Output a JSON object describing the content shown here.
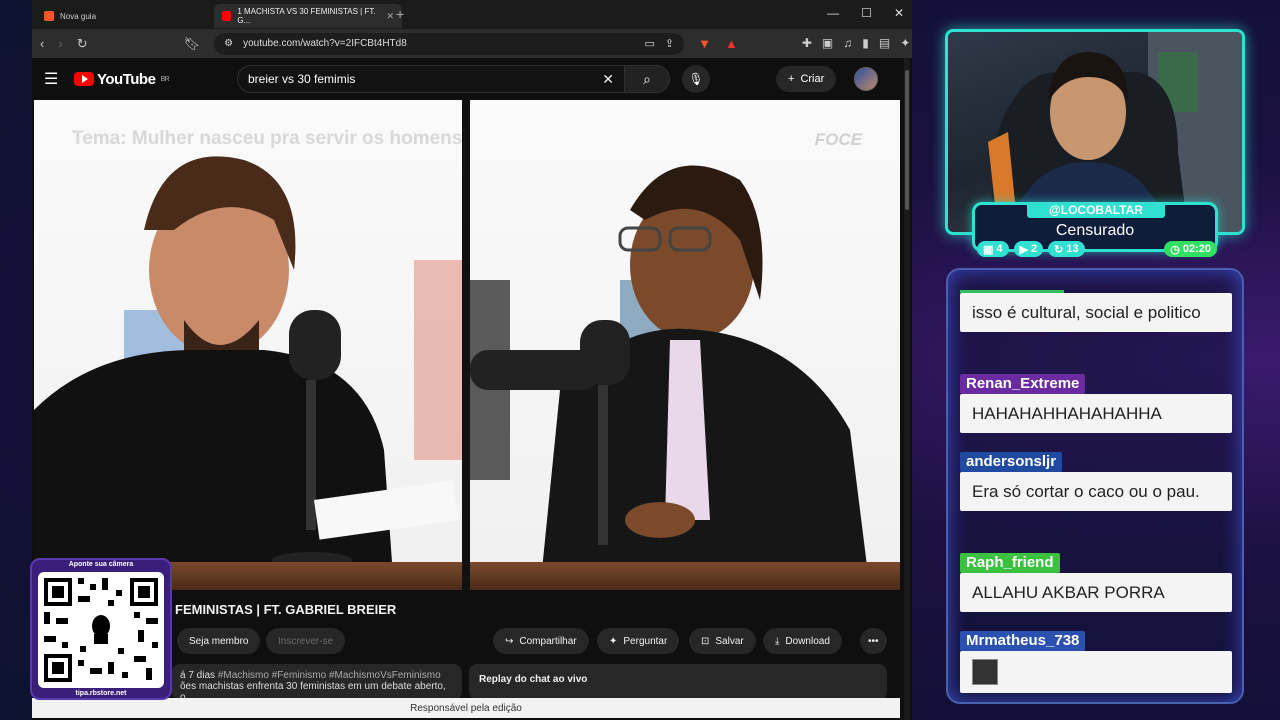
{
  "browser": {
    "tabs": [
      {
        "label": "Nova guia"
      },
      {
        "label": "1 MACHISTA VS 30 FEMINISTAS | FT. G..."
      }
    ],
    "url": "youtube.com/watch?v=2IFCBt4HTd8"
  },
  "youtube": {
    "brand": "YouTube",
    "region": "BR",
    "search_value": "breier vs 30 femimis",
    "create_label": "Criar",
    "video_overlay_title": "Tema: Mulher nasceu pra servir os homens",
    "watermark": "FOCE",
    "video_title": "FEMINISTAS | FT. GABRIEL BREIER",
    "member_label": "Seja membro",
    "subscribe_label": "Inscrever-se",
    "share_label": "Compartilhar",
    "ask_label": "Perguntar",
    "save_label": "Salvar",
    "download_label": "Download",
    "desc_age": "á 7 dias",
    "desc_tags": "#Machismo #Feminismo #MachismoVsFeminismo",
    "desc_snippet": "ões machistas enfrenta 30 feministas em um debate aberto, o",
    "replay_label": "Replay do chat ao vivo",
    "footer_label": "Responsável pela edição"
  },
  "qr": {
    "caption_top": "Aponte sua câmera",
    "caption_bottom": "tipa.rbstore.net"
  },
  "stream": {
    "username": "@LOCOBALTAR",
    "status": "Censurado",
    "stats": {
      "chat": "4",
      "video": "2",
      "subs": "13",
      "time": "02:20"
    }
  },
  "chat": {
    "messages": [
      {
        "user": "",
        "text": "isso é cultural, social e politico",
        "color": "#30c060"
      },
      {
        "user": "Renan_Extreme",
        "text": "HAHAHAHHAHAHAHHA",
        "color": "#6a2aa0"
      },
      {
        "user": "andersonsljr",
        "text": "Era só cortar o caco ou o pau.",
        "color": "#1f4aa0"
      },
      {
        "user": "Raph_friend",
        "text": "ALLAHU AKBAR PORRA",
        "color": "#3cc040"
      },
      {
        "user": "Mrmatheus_738",
        "text": "",
        "color": "#2a50b0"
      }
    ]
  }
}
